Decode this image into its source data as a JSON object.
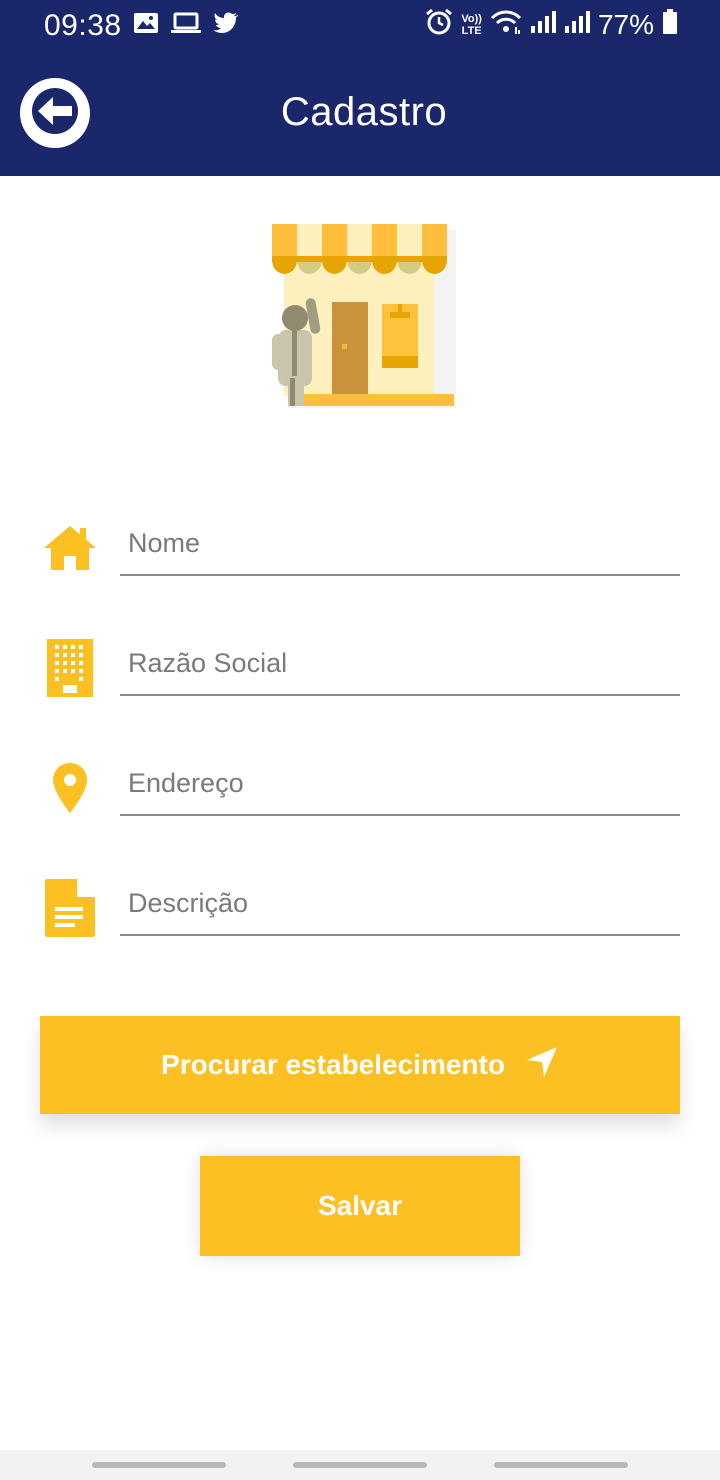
{
  "status_bar": {
    "time": "09:38",
    "battery": "77%",
    "left_icons": [
      "image-icon",
      "laptop-icon",
      "twitter-icon"
    ],
    "right_icons": [
      "alarm-icon",
      "volte-icon",
      "wifi-icon",
      "signal-icon",
      "signal-icon",
      "battery-icon"
    ],
    "volte_top": "Vo))",
    "volte_bottom": "LTE"
  },
  "app_bar": {
    "title": "Cadastro",
    "background": "#1b276b"
  },
  "form": {
    "fields": [
      {
        "icon": "home-icon",
        "placeholder": "Nome"
      },
      {
        "icon": "building-icon",
        "placeholder": "Razão Social"
      },
      {
        "icon": "location-pin-icon",
        "placeholder": "Endereço"
      },
      {
        "icon": "document-icon",
        "placeholder": "Descrição"
      }
    ]
  },
  "buttons": {
    "search_label": "Procurar estabelecimento",
    "save_label": "Salvar",
    "accent": "#fcc022"
  }
}
